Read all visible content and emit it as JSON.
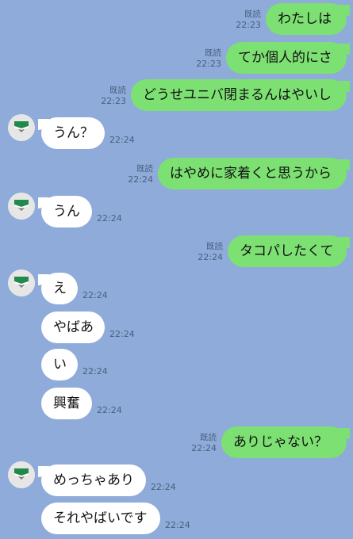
{
  "colors": {
    "background": "#8eabda",
    "outgoing_bubble": "#7de073",
    "incoming_bubble": "#ffffff",
    "meta_text": "#4a5f7e"
  },
  "messages": [
    {
      "dir": "out",
      "text": "わたしは",
      "read": "既読",
      "time": "22:23"
    },
    {
      "dir": "out",
      "text": "てか個人的にさ",
      "read": "既読",
      "time": "22:23"
    },
    {
      "dir": "out",
      "text": "どうせユニバ閉まるんはやいし",
      "read": "既読",
      "time": "22:23"
    },
    {
      "dir": "in",
      "text": "うん？",
      "time": "22:24",
      "avatar": true
    },
    {
      "dir": "out",
      "text": "はやめに家着くと思うから",
      "read": "既読",
      "time": "22:24"
    },
    {
      "dir": "in",
      "text": "うん",
      "time": "22:24",
      "avatar": true
    },
    {
      "dir": "out",
      "text": "タコパしたくて",
      "read": "既読",
      "time": "22:24"
    },
    {
      "dir": "in",
      "text": "え",
      "time": "22:24",
      "avatar": true
    },
    {
      "dir": "in",
      "text": "やばあ",
      "time": "22:24"
    },
    {
      "dir": "in",
      "text": "い",
      "time": "22:24"
    },
    {
      "dir": "in",
      "text": "興奮",
      "time": "22:24"
    },
    {
      "dir": "out",
      "text": "ありじゃない？",
      "read": "既読",
      "time": "22:24"
    },
    {
      "dir": "in",
      "text": "めっちゃあり",
      "time": "22:24",
      "avatar": true
    },
    {
      "dir": "in",
      "text": "それやばいです",
      "time": "22:24"
    }
  ]
}
